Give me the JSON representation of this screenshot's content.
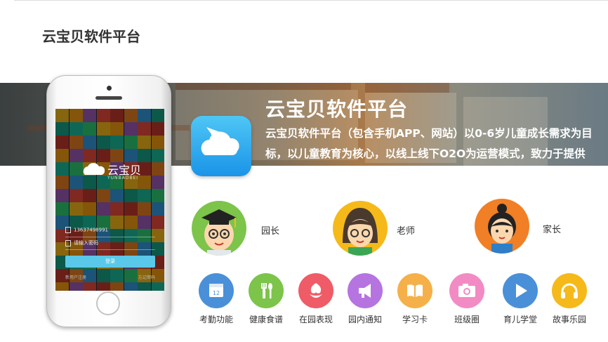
{
  "header": {
    "title": "云宝贝软件平台"
  },
  "banner": {
    "title": "云宝贝软件平台",
    "description": "云宝贝软件平台（包含手机APP、网站）以0-6岁儿童成长需求为目标，以儿童教育为核心，以线上线下O2O为运营模式，致力于提供儿童成长教育解决方案，为儿童成长提供一站式服务平台。",
    "app_icon": "cloud-paper-plane-icon"
  },
  "phone": {
    "logo_text": "云宝贝",
    "logo_sub": "YUNBAOBEI",
    "username_value": "13637498991",
    "password_placeholder": "请输入密码",
    "login_label": "登录",
    "link_left": "新用户注册",
    "link_right": "忘记密码"
  },
  "roles": [
    {
      "label": "园长",
      "color": "#7cc44a"
    },
    {
      "label": "老师",
      "color": "#f5b91a"
    },
    {
      "label": "家长",
      "color": "#f07f26"
    }
  ],
  "features": [
    {
      "label": "考勤功能",
      "color": "#4a90d9",
      "icon": "calendar-icon"
    },
    {
      "label": "健康食谱",
      "color": "#7cc44a",
      "icon": "fork-spoon-icon"
    },
    {
      "label": "在园表现",
      "color": "#ef5b66",
      "icon": "flower-icon"
    },
    {
      "label": "园内通知",
      "color": "#b574e0",
      "icon": "megaphone-icon"
    },
    {
      "label": "学习卡",
      "color": "#f5b04a",
      "icon": "book-icon"
    },
    {
      "label": "班级圈",
      "color": "#f28bc4",
      "icon": "camera-icon"
    },
    {
      "label": "育儿学堂",
      "color": "#4a90d9",
      "icon": "play-icon"
    },
    {
      "label": "故事乐园",
      "color": "#f5b91a",
      "icon": "headphones-icon"
    }
  ]
}
